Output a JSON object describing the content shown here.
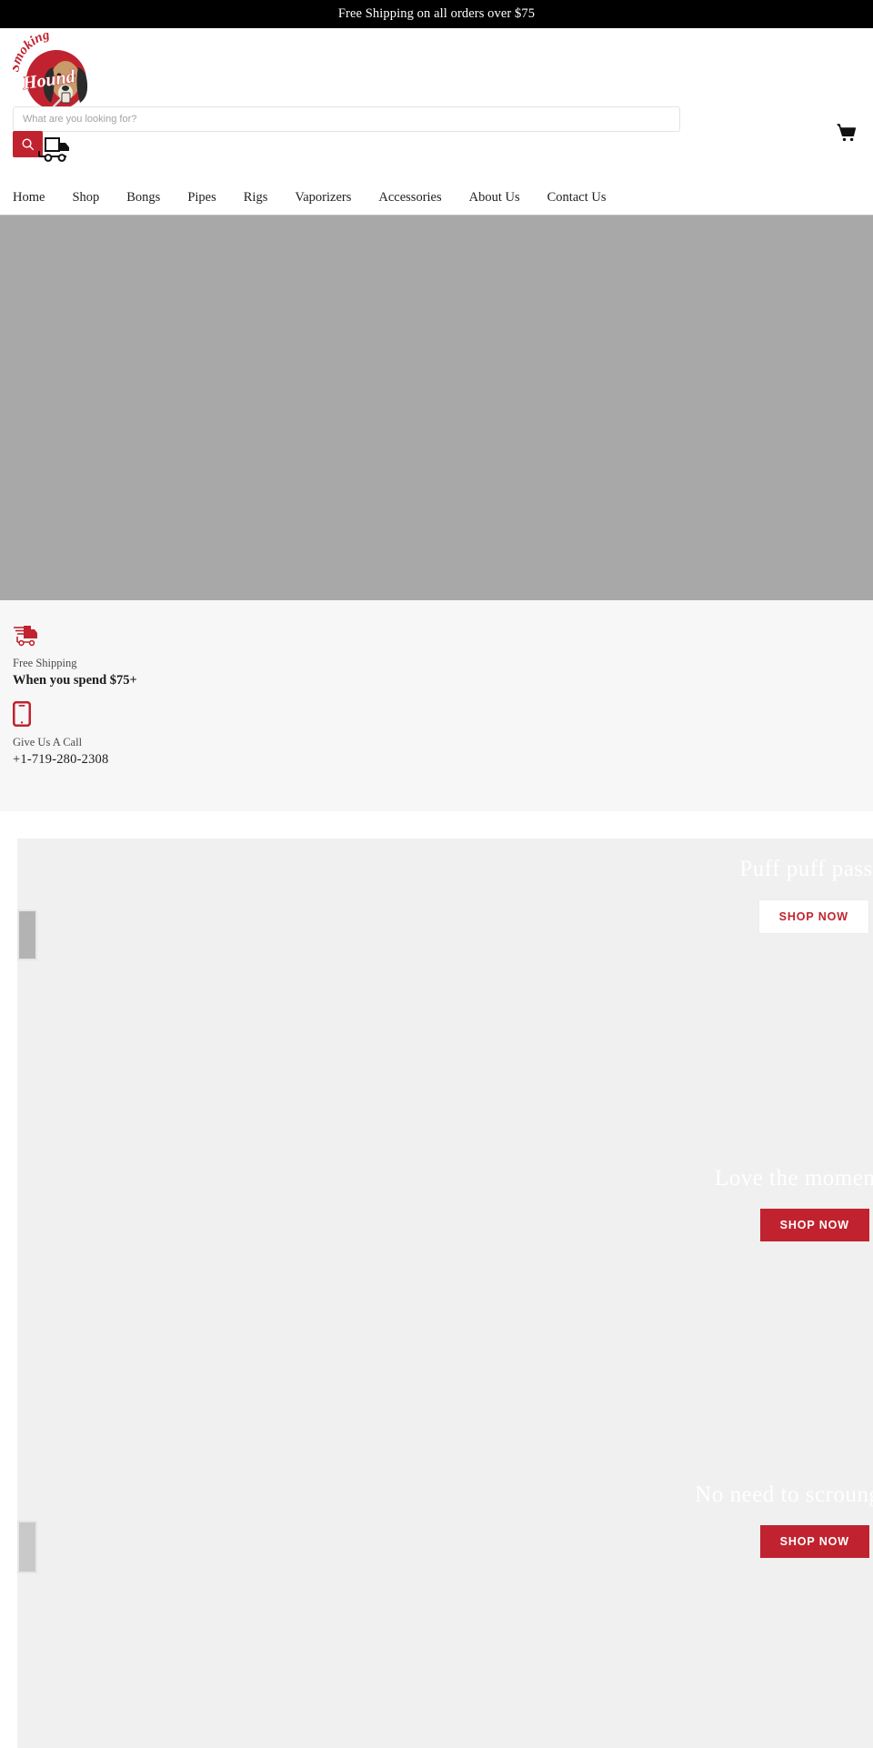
{
  "announcement": {
    "text": "Free Shipping on all orders over $75"
  },
  "header": {
    "logo_alt": "Smoking Hound",
    "logo_word_top": "Smoking",
    "logo_word_bottom": "Hound",
    "cart_icon": "shopping-cart-icon",
    "search": {
      "placeholder": "What are you looking for?",
      "value": "",
      "button_icon": "search-icon"
    },
    "truck_icon": "delivery-truck-icon"
  },
  "nav": {
    "items": [
      {
        "label": "Home"
      },
      {
        "label": "Shop"
      },
      {
        "label": "Bongs"
      },
      {
        "label": "Pipes"
      },
      {
        "label": "Rigs"
      },
      {
        "label": "Vaporizers"
      },
      {
        "label": "Accessories"
      },
      {
        "label": "About Us"
      },
      {
        "label": "Contact Us"
      }
    ]
  },
  "hero": {
    "background_color": "#a8a8a8"
  },
  "value_props": [
    {
      "icon": "delivery-truck-icon",
      "title": "Free Shipping",
      "subtitle": "When you spend $75+"
    },
    {
      "icon": "mobile-phone-icon",
      "title": "Give Us A Call",
      "subtitle": "+1-719-280-2308"
    }
  ],
  "promos": [
    {
      "title": "Puff puff pass...",
      "button_label": "SHOP NOW",
      "button_style": "light"
    },
    {
      "title": "Love the moments",
      "button_label": "SHOP NOW",
      "button_style": "solid"
    },
    {
      "title": "No need to scrounge",
      "button_label": "SHOP NOW",
      "button_style": "solid"
    }
  ],
  "colors": {
    "brand_red": "#c0232f",
    "announcement_bg": "#000000",
    "hero_placeholder": "#a8a8a8",
    "valueprops_bg": "#f7f7f7",
    "promo_bg": "#f0f0f0"
  }
}
